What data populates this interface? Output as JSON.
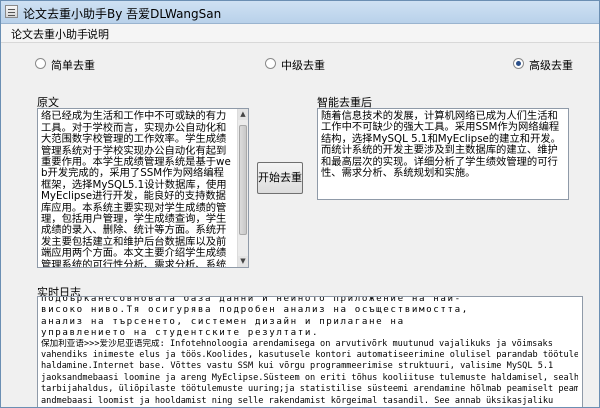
{
  "window": {
    "title": "论文去重小助手By 吾爱DLWangSan"
  },
  "menu": [
    {
      "label": "论文去重小助手"
    },
    {
      "label": "说明"
    }
  ],
  "modes": [
    {
      "label": "简单去重",
      "selected": false
    },
    {
      "label": "中级去重",
      "selected": false
    },
    {
      "label": "高级去重",
      "selected": true
    }
  ],
  "labels": {
    "source": "原文",
    "output": "智能去重后",
    "log": "实时日志"
  },
  "buttons": {
    "start": "开始去重"
  },
  "source_text": "随着信息技术不断普及和应用，计算机网络已经成为生活和工作中不可或缺的有力工具。对于学校而言，实现办公自动化和大范围数字校管理的工作效率。学生成绩管理系统对于学校实现办公自动化有起到重要作用。本学生成绩管理系统是基于web开发完成的，采用了SSM作为网络编程框架，选择MySQL5.1设计数据库，使用MyEclipse进行开发，能良好的支持数据库应用。本系统主要实现对学生成绩的管理，包括用户管理，学生成绩查询，学生成绩的录入、删除、统计等方面。系统开发主要包括建立和维护后台数据库以及前端应用两个方面。本文主要介绍学生成绩管理系统的可行性分析、需求分析、系统设计和系统实现等。",
  "output_text": "随着信息技术的发展，计算机网络已成为人们生活和工作中不可缺少的强大工具。采用SSM作为网络编程结构，选择MySQL 5.1和MyEclipse的建立和开发。而统计系统的开发主要涉及到主数据库的建立、维护和最高层次的实现。详细分析了学生绩效管理的可行性、需求分析、系统规划和实施。",
  "log_lines": [
    "подбърканесовновата база данни и нейното приложение на най-",
    "високо ниво.Тя осигурява подробен анализ на осъществимостта,",
    "анализ на търсенето, системен дизайн и прилагане на",
    "управлението на студентските резултати.",
    "保加利亚语>>>爱沙尼亚语完成: Infotehnoloogia arendamisega on arvutivõrk muutunud vajalikuks ja võimsaks",
    "vahendiks inimeste elus ja töös.Koolides, kasutusele kontori automatiseerimine olulisel parandab töötulemusi kooli",
    "haldamine.Internet base. Võttes vastu SSM kui võrgu programmeerimise struktuuri, valisime MySQL 5.1",
    "jaoksandmebaasi loomine ja areng MyEclipse.Süsteem on eriti tõhus kooliituse tulemuste haldamisel, sealhulgas",
    "tarbijahaldus, üliõpilaste töötulemuste uuring;ja statistilise süsteemi arendamine hõlmab peamiselt peamise",
    "andmebaasi loomist ja hooldamist ning selle rakendamist kõrgeimal tasandil. See annab üksikasjaliku"
  ]
}
